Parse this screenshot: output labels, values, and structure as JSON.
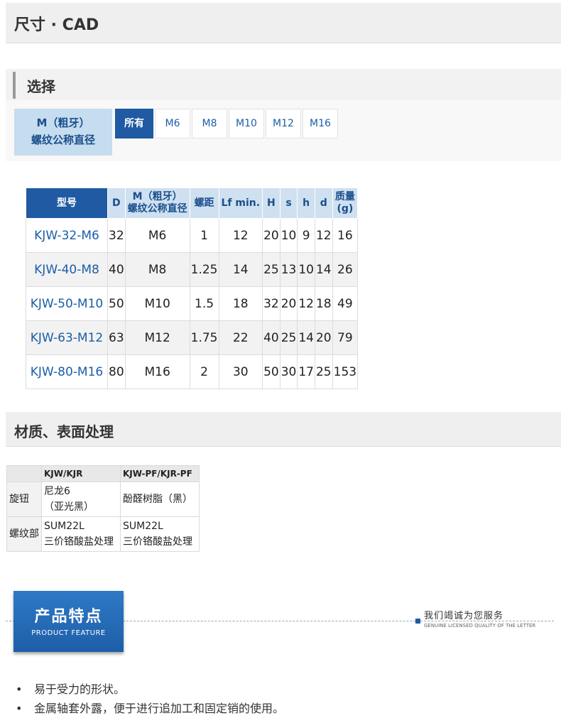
{
  "sections": {
    "dimensions": "尺寸 · CAD",
    "selection": "选择",
    "material": "材质、表面处理"
  },
  "filter": {
    "label_line1": "M（粗牙）",
    "label_line2": "螺纹公称直径",
    "options": [
      "所有",
      "M6",
      "M8",
      "M10",
      "M12",
      "M16"
    ],
    "selected": "所有"
  },
  "dims_table": {
    "headers": [
      "型号",
      "D",
      "M（粗牙）螺纹公称直径",
      "螺距",
      "Lf min.",
      "H",
      "s",
      "h",
      "d",
      "质量(g)"
    ],
    "header_m_line1": "M（粗牙）",
    "header_m_line2": "螺纹公称直径",
    "header_mass_line1": "质量",
    "header_mass_line2": "(g)",
    "rows": [
      [
        "KJW-32-M6",
        "32",
        "M6",
        "1",
        "12",
        "20",
        "10",
        "9",
        "12",
        "16"
      ],
      [
        "KJW-40-M8",
        "40",
        "M8",
        "1.25",
        "14",
        "25",
        "13",
        "10",
        "14",
        "26"
      ],
      [
        "KJW-50-M10",
        "50",
        "M10",
        "1.5",
        "18",
        "32",
        "20",
        "12",
        "18",
        "49"
      ],
      [
        "KJW-63-M12",
        "63",
        "M12",
        "1.75",
        "22",
        "40",
        "25",
        "14",
        "20",
        "79"
      ],
      [
        "KJW-80-M16",
        "80",
        "M16",
        "2",
        "30",
        "50",
        "30",
        "17",
        "25",
        "153"
      ]
    ]
  },
  "material_table": {
    "headers": [
      "",
      "KJW/KJR",
      "KJW-PF/KJR-PF"
    ],
    "rows": [
      {
        "label": "旋钮",
        "col1_line1": "尼龙6",
        "col1_line2": "（亚光黑）",
        "col2_line1": "酚醛树脂（黑）",
        "col2_line2": ""
      },
      {
        "label": "螺纹部",
        "col1_line1": "SUM22L",
        "col1_line2": "三价铬酸盐处理",
        "col2_line1": "SUM22L",
        "col2_line2": "三价铬酸盐处理"
      }
    ]
  },
  "feature": {
    "title_cn": "产品特点",
    "title_en": "PRODUCT FEATURE",
    "slogan_cn": "我们竭诚为您服务",
    "slogan_en": "GENUINE LICENSED QUALITY OF THE LETTER",
    "accent_color": "#1f5aa3"
  },
  "bullets": [
    "易于受力的形状。",
    "金属轴套外露，便于进行追加工和固定销的使用。"
  ]
}
